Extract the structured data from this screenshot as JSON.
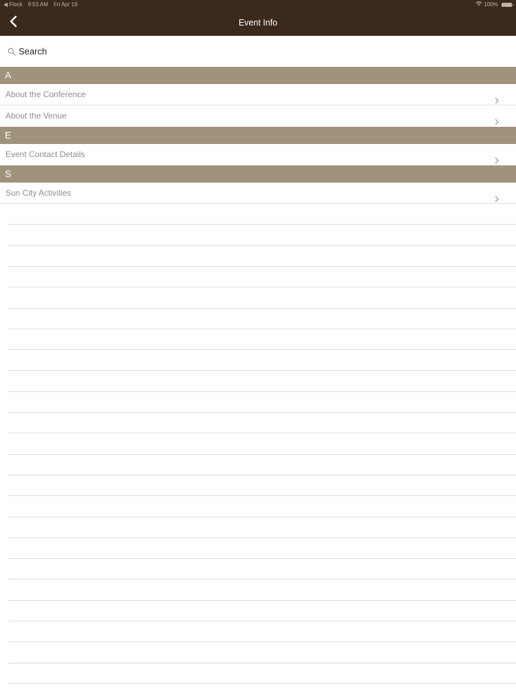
{
  "status_bar": {
    "carrier": "◀ Flock",
    "time": "9:53 AM",
    "date": "Fri Apr 19",
    "battery": "100%",
    "icons": [
      "wifi-icon",
      "battery-icon"
    ]
  },
  "nav": {
    "title": "Event Info",
    "back_icon": "chevron-left-icon"
  },
  "search": {
    "placeholder": "Search",
    "icon": "search-icon"
  },
  "sections": [
    {
      "header": "A",
      "items": [
        "About the Conference",
        "About the Venue"
      ]
    },
    {
      "header": "E",
      "items": [
        "Event Contact Details"
      ]
    },
    {
      "header": "S",
      "items": [
        "Sun City Activities"
      ]
    }
  ],
  "colors": {
    "nav_background": "#3b2a1c",
    "section_header": "#a0937c",
    "item_text": "#8e8e8e",
    "separator": "#dedede"
  }
}
